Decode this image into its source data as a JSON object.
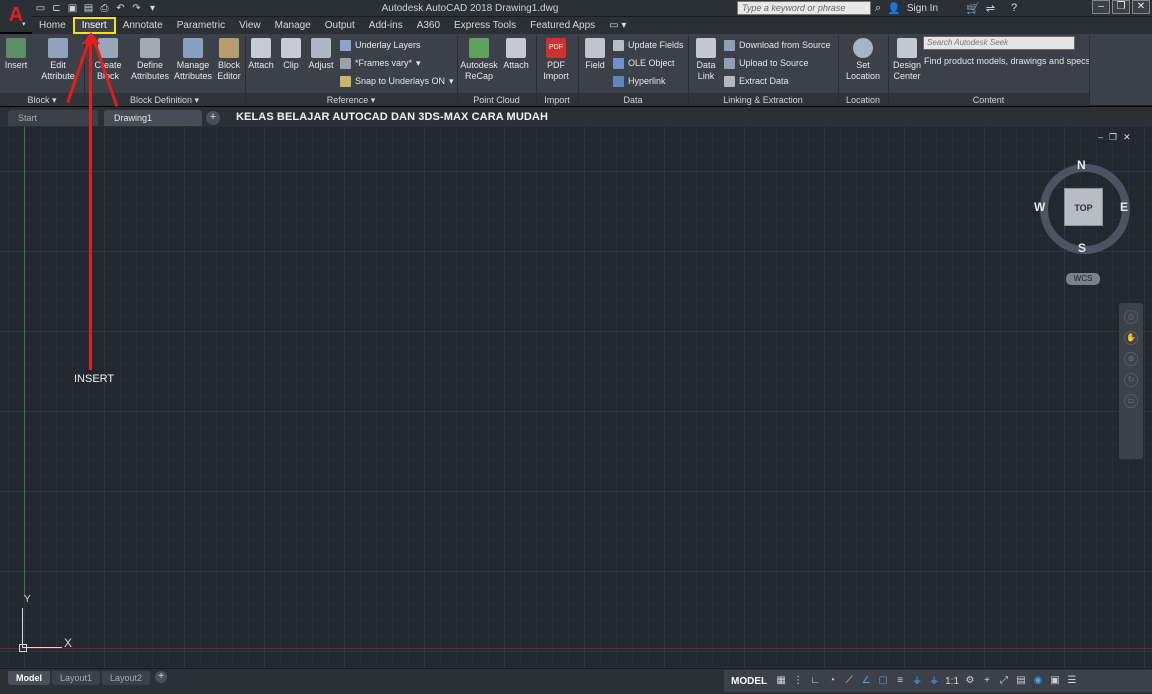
{
  "titlebar": {
    "app_logo": "A",
    "window_title": "Autodesk AutoCAD 2018    Drawing1.dwg",
    "search_placeholder": "Type a keyword or phrase",
    "sign_in": "Sign In"
  },
  "tabs": [
    "Home",
    "Insert",
    "Annotate",
    "Parametric",
    "View",
    "Manage",
    "Output",
    "Add-ins",
    "A360",
    "Express Tools",
    "Featured Apps"
  ],
  "active_tab": "Insert",
  "ribbon": {
    "block": {
      "insert": "Insert",
      "edit_attribute_1": "Edit",
      "edit_attribute_2": "Attribute"
    },
    "block_definition": {
      "create_block_1": "Create",
      "create_block_2": "Block",
      "define_attributes_1": "Define",
      "define_attributes_2": "Attributes",
      "manage_attributes_1": "Manage",
      "manage_attributes_2": "Attributes",
      "block_editor_1": "Block",
      "block_editor_2": "Editor"
    },
    "reference": {
      "attach": "Attach",
      "clip": "Clip",
      "adjust": "Adjust",
      "underlay_layers": "Underlay Layers",
      "frames_vary": "*Frames vary*",
      "snap_to_underlays": "Snap to Underlays ON"
    },
    "point_cloud": {
      "autodesk_recap_1": "Autodesk",
      "autodesk_recap_2": "ReCap",
      "attach": "Attach"
    },
    "import": {
      "pdf_import_1": "PDF",
      "pdf_import_2": "Import",
      "pdf_badge": "PDF"
    },
    "data": {
      "field": "Field",
      "update_fields": "Update Fields",
      "ole_object": "OLE Object",
      "hyperlink": "Hyperlink"
    },
    "linking": {
      "data_link_1": "Data",
      "data_link_2": "Link",
      "download_from_source": "Download from Source",
      "upload_to_source": "Upload to Source",
      "extract_data": "Extract  Data"
    },
    "location": {
      "set_location_1": "Set",
      "set_location_2": "Location"
    },
    "content": {
      "design_center_1": "Design",
      "design_center_2": "Center",
      "seek_placeholder": "Search Autodesk Seek",
      "seek_text": "Find product models, drawings and specs"
    },
    "panel_titles": {
      "block": "Block ▾",
      "block_definition": "Block Definition ▾",
      "reference": "Reference ▾",
      "point_cloud": "Point Cloud",
      "import": "Import",
      "data": "Data",
      "linking": "Linking & Extraction",
      "location": "Location",
      "content": "Content"
    }
  },
  "file_tabs": [
    "Start",
    "Drawing1"
  ],
  "overlay_title": "KELAS BELAJAR AUTOCAD DAN 3DS-MAX CARA MUDAH",
  "viewcube": {
    "face": "TOP",
    "north": "N",
    "south": "S",
    "east": "E",
    "west": "W",
    "wcs": "WCS"
  },
  "annotation": {
    "label": "INSERT",
    "color": "#e21e1e",
    "highlight_color": "#f5e600"
  },
  "ucs": {
    "x_label": "X",
    "y_label": "Y"
  },
  "layout_tabs": [
    "Model",
    "Layout1",
    "Layout2"
  ],
  "status": {
    "model": "MODEL",
    "scale": "1:1"
  },
  "colors": {
    "drawing_bg": "#212830",
    "ribbon_bg": "#3b4049",
    "titlebar_bg": "#2b2f36"
  }
}
